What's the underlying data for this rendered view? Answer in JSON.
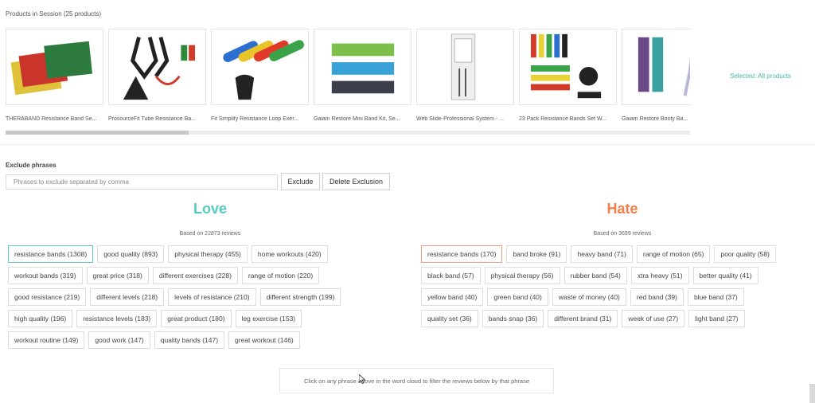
{
  "products_section": {
    "title": "Products in Session (25 products)",
    "selected_label": "Selected: All products",
    "products": [
      {
        "caption": "THERABAND Resistance Band Se...",
        "icon": "flat-resistance-bands-image",
        "colors": [
          "#c9342b",
          "#e0c23a",
          "#2d7a3e"
        ]
      },
      {
        "caption": "ProsourceFit Tube Resistance Ba...",
        "icon": "tube-resistance-bands-image",
        "colors": [
          "#222222",
          "#d23a2a",
          "#2e8a3a"
        ]
      },
      {
        "caption": "Fit Simplify Resistance Loop Exer...",
        "icon": "loop-bands-image",
        "colors": [
          "#2d6fd0",
          "#e8c42a",
          "#e23a2a",
          "#3aa34a",
          "#222222"
        ]
      },
      {
        "caption": "Gaiam Restore Mini Band Kit, Se...",
        "icon": "mini-band-kit-image",
        "colors": [
          "#7cc04a",
          "#3aa0d8",
          "#3b3f4a"
        ]
      },
      {
        "caption": "Web Slide-Professional System - ...",
        "icon": "wall-system-image",
        "colors": [
          "#b8b8b8",
          "#555555"
        ]
      },
      {
        "caption": "23 Pack Resistance Bands Set W...",
        "icon": "bands-set-image",
        "colors": [
          "#222222",
          "#e8d23a",
          "#3aa34a",
          "#d23a2a",
          "#2d6fd0"
        ]
      },
      {
        "caption": "Gaiam Restore Booty Ba...",
        "icon": "booty-band-image",
        "colors": [
          "#6b4a8a",
          "#3aa0a0",
          "#b8b8d8"
        ]
      }
    ]
  },
  "exclude": {
    "title": "Exclude phrases",
    "placeholder": "Phrases to exclude separated by comma",
    "exclude_label": "Exclude",
    "delete_label": "Delete Exclusion"
  },
  "love": {
    "title": "Love",
    "color": "#52cbbf",
    "based_on": "Based on 22873 reviews",
    "rows": [
      [
        "resistance bands (1308)",
        "good quality (893)",
        "physical therapy (455)",
        "home workouts (420)"
      ],
      [
        "workout bands (319)",
        "great price (318)",
        "different exercises (228)",
        "range of motion (220)"
      ],
      [
        "good resistance (219)",
        "different levels (218)",
        "levels of resistance (210)",
        "different strength (199)"
      ],
      [
        "high quality (196)",
        "resistance levels (183)",
        "great product (180)",
        "leg exercise (153)"
      ],
      [
        "workout routine (149)",
        "good work (147)",
        "quality bands (147)",
        "great workout (146)"
      ]
    ]
  },
  "hate": {
    "title": "Hate",
    "color": "#f27d4a",
    "based_on": "Based on 3699 reviews",
    "rows": [
      [
        "resistance bands (170)",
        "band broke (91)",
        "heavy band (71)",
        "range of motion (65)",
        "poor quality (58)"
      ],
      [
        "black band (57)",
        "physical therapy (56)",
        "rubber band (54)",
        "xtra heavy (51)",
        "better quality (41)"
      ],
      [
        "yellow band (40)",
        "green band (40)",
        "waste of money (40)",
        "red band (39)",
        "blue band (37)"
      ],
      [
        "quality set (36)",
        "bands snap (36)",
        "different brand (31)",
        "week of use (27)",
        "light band (27)"
      ]
    ]
  },
  "hint": "Click on any phrase above in the word cloud to filter the reviews below by that phrase"
}
